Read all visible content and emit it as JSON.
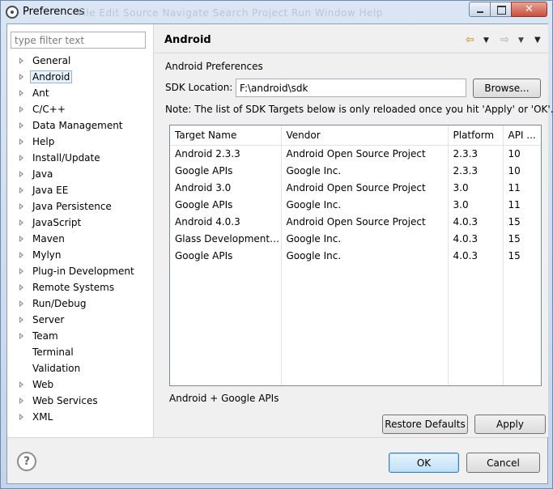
{
  "window": {
    "title": "Preferences",
    "faded_menu": "File   Edit   Source   Navigate   Search   Project   Run   Window   Help",
    "close_glyph": "✕"
  },
  "filter": {
    "placeholder": "type filter text",
    "value": ""
  },
  "tree": {
    "items": [
      {
        "label": "General",
        "expandable": true
      },
      {
        "label": "Android",
        "expandable": true,
        "selected": true
      },
      {
        "label": "Ant",
        "expandable": true
      },
      {
        "label": "C/C++",
        "expandable": true
      },
      {
        "label": "Data Management",
        "expandable": true
      },
      {
        "label": "Help",
        "expandable": true
      },
      {
        "label": "Install/Update",
        "expandable": true
      },
      {
        "label": "Java",
        "expandable": true
      },
      {
        "label": "Java EE",
        "expandable": true
      },
      {
        "label": "Java Persistence",
        "expandable": true
      },
      {
        "label": "JavaScript",
        "expandable": true
      },
      {
        "label": "Maven",
        "expandable": true
      },
      {
        "label": "Mylyn",
        "expandable": true
      },
      {
        "label": "Plug-in Development",
        "expandable": true
      },
      {
        "label": "Remote Systems",
        "expandable": true
      },
      {
        "label": "Run/Debug",
        "expandable": true
      },
      {
        "label": "Server",
        "expandable": true
      },
      {
        "label": "Team",
        "expandable": true
      },
      {
        "label": "Terminal",
        "expandable": false
      },
      {
        "label": "Validation",
        "expandable": false
      },
      {
        "label": "Web",
        "expandable": true
      },
      {
        "label": "Web Services",
        "expandable": true
      },
      {
        "label": "XML",
        "expandable": true
      }
    ]
  },
  "page": {
    "title": "Android",
    "section_label": "Android Preferences",
    "sdk_label": "SDK Location:",
    "sdk_value": "F:\\android\\sdk",
    "browse_label": "Browse...",
    "note": "Note: The list of SDK Targets below is only reloaded once you hit 'Apply' or 'OK'.",
    "nav": {
      "back": "⇦",
      "back_dropdown": "▼",
      "forward": "⇨",
      "forward_dropdown": "▼",
      "menu": "▼"
    },
    "table": {
      "headers": [
        "Target Name",
        "Vendor",
        "Platform",
        "API ..."
      ],
      "rows": [
        [
          "Android 2.3.3",
          "Android Open Source Project",
          "2.3.3",
          "10"
        ],
        [
          "Google APIs",
          "Google Inc.",
          "2.3.3",
          "10"
        ],
        [
          "Android 3.0",
          "Android Open Source Project",
          "3.0",
          "11"
        ],
        [
          "Google APIs",
          "Google Inc.",
          "3.0",
          "11"
        ],
        [
          "Android 4.0.3",
          "Android Open Source Project",
          "4.0.3",
          "15"
        ],
        [
          "Glass Development Kit Preview",
          "Google Inc.",
          "4.0.3",
          "15"
        ],
        [
          "Google APIs",
          "Google Inc.",
          "4.0.3",
          "15"
        ]
      ]
    },
    "selection_info": "Android + Google APIs",
    "restore_defaults_label": "Restore Defaults",
    "apply_label": "Apply"
  },
  "footer": {
    "help_glyph": "?",
    "ok_label": "OK",
    "cancel_label": "Cancel"
  }
}
